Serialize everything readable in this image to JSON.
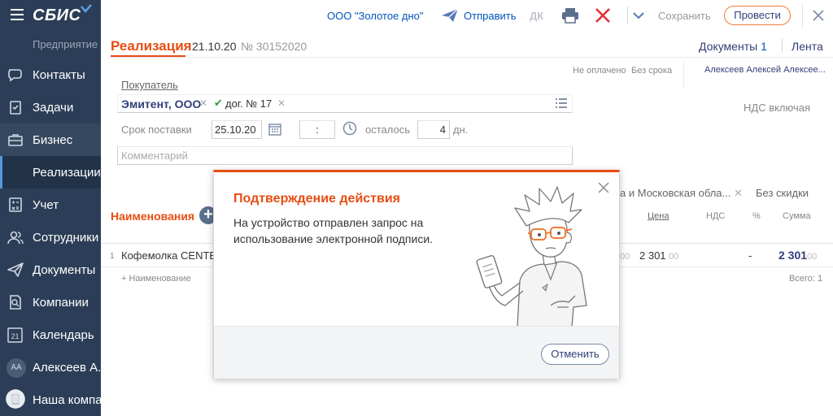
{
  "sidebar": {
    "logo": "СБИС",
    "company_sub": "Предприятие",
    "items": [
      {
        "label": "Контакты",
        "icon": "chat-icon"
      },
      {
        "label": "Задачи",
        "icon": "tasks-icon"
      },
      {
        "label": "Бизнес",
        "icon": "briefcase-icon"
      },
      {
        "label": "Реализации",
        "icon": ""
      },
      {
        "label": "Учет",
        "icon": "calculator-icon"
      },
      {
        "label": "Сотрудники",
        "icon": "people-icon"
      },
      {
        "label": "Документы",
        "icon": "send-icon"
      },
      {
        "label": "Компании",
        "icon": "company-icon"
      },
      {
        "label": "Календарь",
        "icon": "calendar-icon"
      },
      {
        "label": "Алексеев А...",
        "icon": "avatar",
        "avatar_initials": "АА"
      },
      {
        "label": "Наша компа...",
        "icon": "company-avatar"
      }
    ],
    "colors": {
      "bg": "#2c3e57",
      "active": "#223249",
      "accent": "#5599dd"
    }
  },
  "toolbar": {
    "org": "ООО \"Золотое дно\"",
    "send": "Отправить",
    "dk": "ДК",
    "save": "Сохранить",
    "post": "Провести"
  },
  "header": {
    "title": "Реализация",
    "date": "21.10.20",
    "number": "№ 30152020",
    "documents_label": "Документы",
    "documents_count": "1",
    "feed": "Лента"
  },
  "status": {
    "payment": "Не оплачено",
    "deadline": "Без срока",
    "assignee": "Алексеев Алексей Алексее..."
  },
  "form": {
    "buyer_label": "Покупатель",
    "buyer_name": "Эмитент, ООО",
    "contract": "дог. № 17",
    "vat": "НДС включая",
    "delivery_label": "Срок поставки",
    "delivery_date": "25.10.20",
    "delivery_time": ":",
    "left_label": "осталось",
    "days": "4",
    "days_unit": "дн.",
    "comment_placeholder": "Комментарий",
    "region": "а и Московская обла...",
    "no_discount": "Без скидки"
  },
  "table": {
    "title": "Наименования",
    "headers": {
      "price": "Цена",
      "vat": "НДС",
      "pct": "%",
      "sum": "Сумма"
    },
    "rows": [
      {
        "num": "1",
        "name": "Кофемолка CENTE",
        "qty_frac": "00",
        "price": "2 301",
        "price_frac": "00",
        "vat": "-",
        "sum": "2 301",
        "sum_frac": "00"
      }
    ],
    "add_label": "+ Наименование",
    "total": "Всего: 1"
  },
  "modal": {
    "title": "Подтверждение действия",
    "message": "На устройство отправлен запрос на использование электронной подписи.",
    "cancel": "Отменить"
  },
  "colors": {
    "accent": "#e64e13",
    "link": "#0055bb",
    "text": "#313e78"
  }
}
